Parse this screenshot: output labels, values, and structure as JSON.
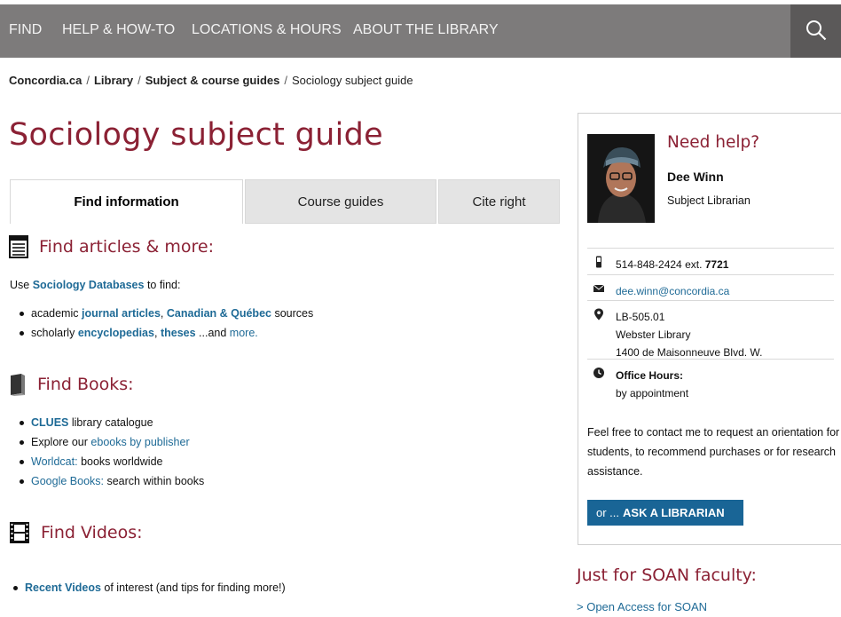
{
  "nav": {
    "items": [
      "FIND",
      "HELP & HOW-TO",
      "LOCATIONS & HOURS",
      "ABOUT THE LIBRARY"
    ],
    "search_icon": "search-icon"
  },
  "breadcrumb": {
    "items": [
      "Concordia.ca",
      "Library",
      "Subject & course guides"
    ],
    "current": "Sociology subject guide",
    "separator": "/"
  },
  "page": {
    "title": "Sociology subject guide"
  },
  "tabs": [
    "Find information",
    "Course guides",
    "Cite right"
  ],
  "articles": {
    "heading": "Find articles & more:",
    "intro_pre": "Use",
    "intro_link": "Sociology Databases",
    "intro_post": "to find:",
    "line1": {
      "pre": "academic",
      "link1": "journal articles",
      "comma": ",",
      "link2": "Canadian & Québec",
      "post": "sources"
    },
    "line2": {
      "pre": "scholarly",
      "link1": "encyclopedias",
      "comma": ",",
      "link2": "theses",
      "mid": "...and",
      "link3": "more."
    }
  },
  "books": {
    "heading": "Find Books:",
    "items": [
      {
        "link": "CLUES",
        "text": "library catalogue"
      },
      {
        "pre": "Explore our",
        "link": "ebooks by publisher"
      },
      {
        "link": "Worldcat:",
        "text": "books worldwide"
      },
      {
        "link": "Google Books:",
        "text": "search within books"
      }
    ]
  },
  "videos": {
    "heading": "Find Videos:",
    "item": {
      "link": "Recent Videos",
      "text": "of interest (and tips for finding more!)"
    }
  },
  "sidebar": {
    "heading": "Need help?",
    "name": "Dee Winn",
    "role": "Subject Librarian",
    "phone": "514-848-2424 ext.",
    "ext": "7721",
    "email": "dee.winn@concordia.ca",
    "room": "LB-505.01",
    "building": "Webster Library",
    "street": "1400 de Maisonneuve Blvd. W.",
    "hours_label": "Office Hours:",
    "hours_value": "by appointment",
    "blurb": "Feel free to contact me to request an orientation for students, to recommend purchases or for research assistance.",
    "ask_pre": "or ...",
    "ask_label": "ASK A LIBRARIAN"
  },
  "faculty": {
    "heading": "Just for SOAN faculty:",
    "link": "> Open Access for SOAN"
  },
  "colors": {
    "maroon": "#8b2134",
    "link": "#1e6a96",
    "nav": "#7d7b7b",
    "button": "#196596"
  }
}
